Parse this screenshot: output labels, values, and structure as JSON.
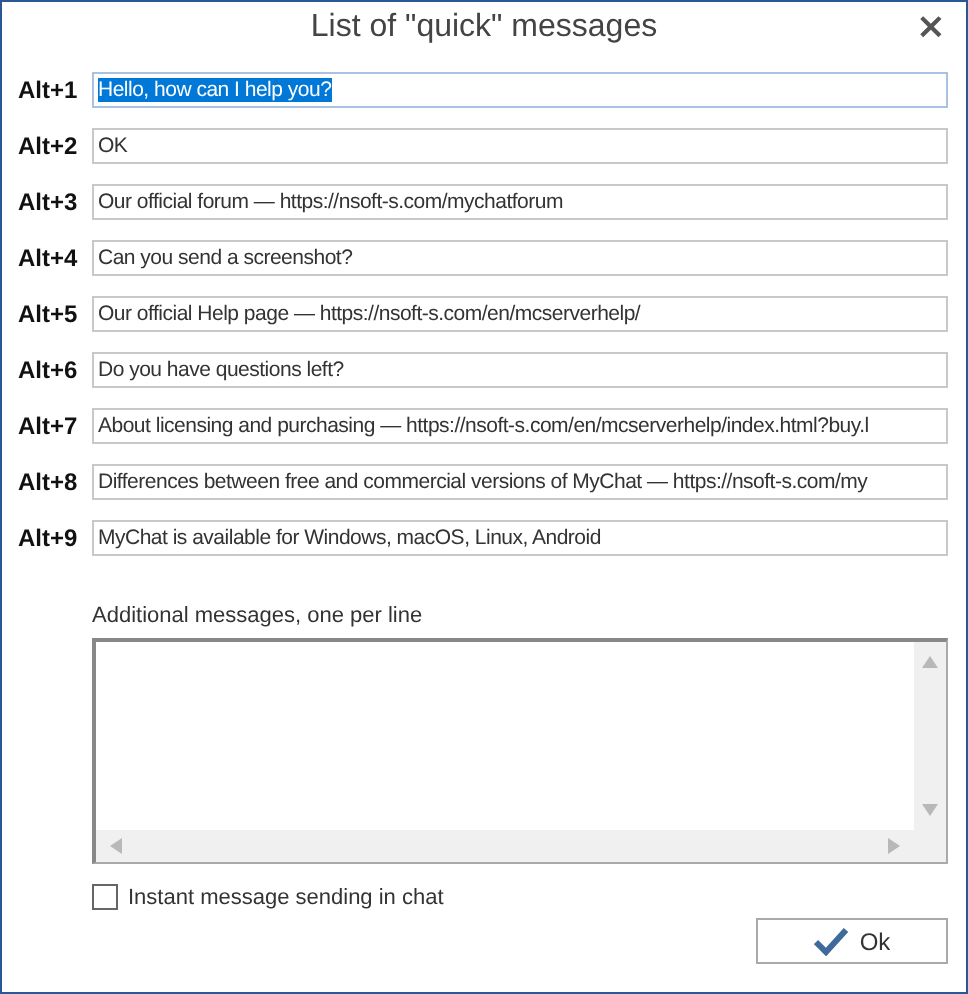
{
  "window": {
    "title": "List of \"quick\" messages",
    "close": "×"
  },
  "messages": [
    {
      "shortcut": "Alt+1",
      "text": "Hello, how can I help you?",
      "selected": true
    },
    {
      "shortcut": "Alt+2",
      "text": "OK",
      "selected": false
    },
    {
      "shortcut": "Alt+3",
      "text": "Our official forum — https://nsoft-s.com/mychatforum",
      "selected": false
    },
    {
      "shortcut": "Alt+4",
      "text": "Can you send a screenshot?",
      "selected": false
    },
    {
      "shortcut": "Alt+5",
      "text": "Our official Help page — https://nsoft-s.com/en/mcserverhelp/",
      "selected": false
    },
    {
      "shortcut": "Alt+6",
      "text": "Do you have questions left?",
      "selected": false
    },
    {
      "shortcut": "Alt+7",
      "text": "About licensing and purchasing — https://nsoft-s.com/en/mcserverhelp/index.html?buy.l",
      "selected": false
    },
    {
      "shortcut": "Alt+8",
      "text": "Differences between free and commercial versions of MyChat — https://nsoft-s.com/my",
      "selected": false
    },
    {
      "shortcut": "Alt+9",
      "text": "MyChat is available for Windows, macOS, Linux, Android",
      "selected": false
    }
  ],
  "additional": {
    "label": "Additional messages, one per line"
  },
  "instant_sending": {
    "label": "Instant message sending in chat",
    "checked": false
  },
  "ok_button": {
    "label": "Ok"
  }
}
